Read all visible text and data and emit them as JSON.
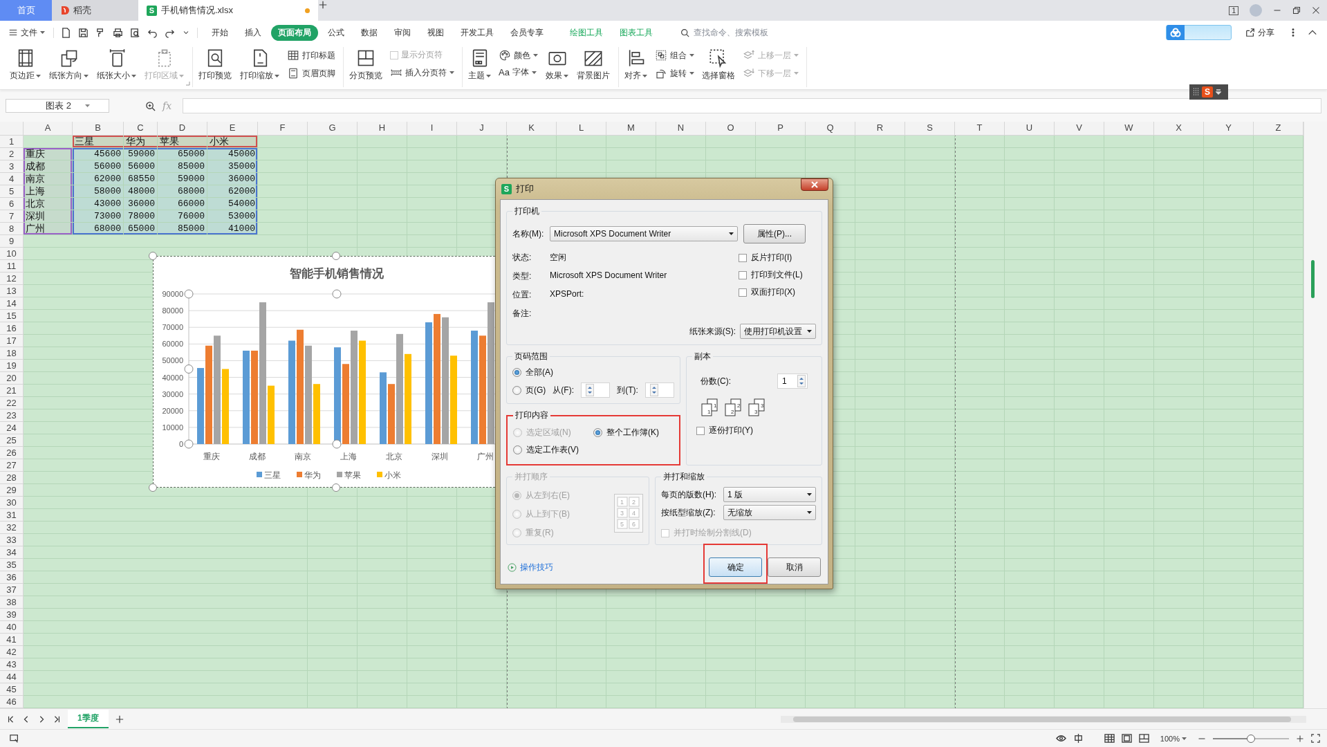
{
  "title_tabs": [
    {
      "label": "首页",
      "kind": "home",
      "selected": false
    },
    {
      "label": "稻壳",
      "kind": "app",
      "selected": false
    },
    {
      "label": "手机销售情况.xlsx",
      "kind": "file",
      "icon_letter": "S",
      "selected": true,
      "modified": true
    }
  ],
  "top_right": {
    "window_count": "1"
  },
  "menu": {
    "file": "文件",
    "tabs": [
      {
        "label": "开始",
        "kind": "standard",
        "selected": false
      },
      {
        "label": "插入",
        "kind": "standard",
        "selected": false
      },
      {
        "label": "页面布局",
        "kind": "standard",
        "selected": true
      },
      {
        "label": "公式",
        "kind": "standard",
        "selected": false
      },
      {
        "label": "数据",
        "kind": "standard",
        "selected": false
      },
      {
        "label": "审阅",
        "kind": "standard",
        "selected": false
      },
      {
        "label": "视图",
        "kind": "standard",
        "selected": false
      },
      {
        "label": "开发工具",
        "kind": "standard",
        "selected": false
      },
      {
        "label": "会员专享",
        "kind": "standard",
        "selected": false
      },
      {
        "label": "绘图工具",
        "kind": "context",
        "selected": false
      },
      {
        "label": "图表工具",
        "kind": "context",
        "selected": false
      }
    ],
    "search": {
      "placeholder": "查找命令、搜索模板"
    },
    "share": "分享"
  },
  "ribbon": {
    "groups": [
      {
        "launcher": true,
        "items": [
          {
            "kind": "large",
            "label": "页边距",
            "dropdown": true,
            "disabled": false
          },
          {
            "kind": "large",
            "label": "纸张方向",
            "dropdown": true,
            "disabled": false
          },
          {
            "kind": "large",
            "label": "纸张大小",
            "dropdown": true,
            "disabled": false
          },
          {
            "kind": "large",
            "label": "打印区域",
            "dropdown": true,
            "disabled": true
          }
        ]
      },
      {
        "items": [
          {
            "kind": "large",
            "label": "打印预览",
            "dropdown": false,
            "disabled": false
          },
          {
            "kind": "large",
            "label": "打印缩放",
            "dropdown": true,
            "disabled": false
          },
          {
            "kind": "stack",
            "items": [
              {
                "kind": "small",
                "label": "打印标题",
                "dropdown": false,
                "disabled": false
              },
              {
                "kind": "small",
                "label": "页眉页脚",
                "dropdown": false,
                "disabled": false
              }
            ]
          }
        ]
      },
      {
        "items": [
          {
            "kind": "large",
            "label": "分页预览",
            "dropdown": false,
            "disabled": false
          },
          {
            "kind": "stack",
            "items": [
              {
                "kind": "checkbox",
                "label": "显示分页符",
                "checked": false,
                "disabled": true
              },
              {
                "kind": "small",
                "label": "插入分页符",
                "dropdown": true,
                "disabled": false
              }
            ]
          }
        ]
      },
      {
        "items": [
          {
            "kind": "large",
            "label": "主题",
            "dropdown": true,
            "disabled": false
          },
          {
            "kind": "stack",
            "items": [
              {
                "kind": "small",
                "label": "颜色",
                "dropdown": true,
                "disabled": false
              },
              {
                "kind": "glyph",
                "glyph": "Aa",
                "label": "字体",
                "dropdown": true,
                "disabled": false
              }
            ]
          },
          {
            "kind": "large",
            "label": "效果",
            "dropdown": true,
            "disabled": false
          },
          {
            "kind": "large",
            "label": "背景图片",
            "dropdown": false,
            "disabled": false
          }
        ]
      },
      {
        "items": [
          {
            "kind": "large",
            "label": "对齐",
            "dropdown": true,
            "disabled": false
          },
          {
            "kind": "stack",
            "items": [
              {
                "kind": "small",
                "label": "组合",
                "dropdown": true,
                "disabled": false
              },
              {
                "kind": "small",
                "label": "旋转",
                "dropdown": true,
                "disabled": false
              }
            ]
          },
          {
            "kind": "large",
            "label": "选择窗格",
            "dropdown": false,
            "disabled": false
          },
          {
            "kind": "stack",
            "items": [
              {
                "kind": "small",
                "label": "上移一层",
                "dropdown": true,
                "disabled": true
              },
              {
                "kind": "small",
                "label": "下移一层",
                "dropdown": true,
                "disabled": true
              }
            ]
          }
        ]
      }
    ]
  },
  "ime_toolbar": {
    "logo": "S"
  },
  "formula_bar": {
    "name_box": "图表 2",
    "fx_label": "fx"
  },
  "sheet": {
    "columns": [
      "A",
      "B",
      "C",
      "D",
      "E",
      "F",
      "G",
      "H",
      "I",
      "J",
      "K",
      "L",
      "M",
      "N",
      "O",
      "P",
      "Q",
      "R",
      "S",
      "T",
      "U",
      "V",
      "W",
      "X",
      "Y",
      "Z"
    ],
    "header": {
      "row": "1",
      "brands": [
        "三星",
        "华为",
        "苹果",
        "小米"
      ]
    },
    "data_rows": [
      {
        "row": "2",
        "city": "重庆",
        "values": [
          "45600",
          "59000",
          "65000",
          "45000"
        ]
      },
      {
        "row": "3",
        "city": "成都",
        "values": [
          "56000",
          "56000",
          "85000",
          "35000"
        ]
      },
      {
        "row": "4",
        "city": "南京",
        "values": [
          "62000",
          "68550",
          "59000",
          "36000"
        ]
      },
      {
        "row": "5",
        "city": "上海",
        "values": [
          "58000",
          "48000",
          "68000",
          "62000"
        ]
      },
      {
        "row": "6",
        "city": "北京",
        "values": [
          "43000",
          "36000",
          "66000",
          "54000"
        ]
      },
      {
        "row": "7",
        "city": "深圳",
        "values": [
          "73000",
          "78000",
          "76000",
          "53000"
        ]
      },
      {
        "row": "8",
        "city": "广州",
        "values": [
          "68000",
          "65000",
          "85000",
          "41000"
        ]
      }
    ],
    "empty_rows": [
      "9",
      "10",
      "11",
      "12",
      "13",
      "14",
      "15",
      "16",
      "17",
      "18",
      "19",
      "20",
      "21",
      "22",
      "23",
      "24",
      "25",
      "26",
      "27",
      "28",
      "29",
      "30",
      "31",
      "32",
      "33",
      "34",
      "35",
      "36",
      "37",
      "38",
      "39",
      "40",
      "41",
      "42",
      "43",
      "44",
      "45",
      "46"
    ]
  },
  "chart": {
    "selected": true,
    "chart_data": {
      "type": "bar",
      "title": "智能手机销售情况",
      "categories": [
        "重庆",
        "成都",
        "南京",
        "上海",
        "北京",
        "深圳",
        "广州"
      ],
      "series": [
        {
          "name": "三星",
          "color": "#5b9bd5",
          "values": [
            45600,
            56000,
            62000,
            58000,
            43000,
            73000,
            68000
          ]
        },
        {
          "name": "华为",
          "color": "#ed7d31",
          "values": [
            59000,
            56000,
            68550,
            48000,
            36000,
            78000,
            65000
          ]
        },
        {
          "name": "苹果",
          "color": "#a5a5a5",
          "values": [
            65000,
            85000,
            59000,
            68000,
            66000,
            76000,
            85000
          ]
        },
        {
          "name": "小米",
          "color": "#ffc000",
          "values": [
            45000,
            35000,
            36000,
            62000,
            54000,
            53000,
            null
          ]
        }
      ],
      "grid": true,
      "legend": "bottom",
      "ylim": [
        0,
        90000
      ],
      "yticks": [
        0,
        10000,
        20000,
        30000,
        40000,
        50000,
        60000,
        70000,
        80000,
        90000
      ]
    }
  },
  "dialog": {
    "title": "打印",
    "icon_letter": "S",
    "printer": {
      "title": "打印机",
      "name_label": "名称(M):",
      "name": "Microsoft XPS Document Writer",
      "properties_button": "属性(P)...",
      "info": [
        {
          "label": "状态:",
          "value": "空闲"
        },
        {
          "label": "类型:",
          "value": "Microsoft XPS Document Writer"
        },
        {
          "label": "位置:",
          "value": "XPSPort:"
        },
        {
          "label": "备注:"
        }
      ],
      "options": [
        {
          "label": "反片打印(I)",
          "checked": false
        },
        {
          "label": "打印到文件(L)",
          "checked": false
        },
        {
          "label": "双面打印(X)",
          "checked": false
        }
      ],
      "source_label": "纸张来源(S):",
      "source": "使用打印机设置"
    },
    "page_range": {
      "title": "页码范围",
      "options": [
        {
          "label": "全部(A)",
          "selected": true
        },
        {
          "label": "页(G)",
          "selected": false
        }
      ],
      "from_label": "从(F):",
      "to_label": "到(T):"
    },
    "print_content": {
      "title": "打印内容",
      "highlighted": true,
      "options": [
        {
          "label": "选定区域(N)",
          "selected": false,
          "disabled": true
        },
        {
          "label": "整个工作簿(K)",
          "selected": true,
          "disabled": false
        },
        {
          "label": "选定工作表(V)",
          "selected": false,
          "disabled": false
        }
      ]
    },
    "copies": {
      "title": "副本",
      "count_label": "份数(C):",
      "count": "1",
      "collate_pages": [
        {
          "back": "1",
          "front": "1"
        },
        {
          "back": "2",
          "front": "2"
        },
        {
          "back": "3",
          "front": "3"
        }
      ],
      "collate": {
        "label": "逐份打印(Y)",
        "checked": false
      }
    },
    "order": {
      "title": "并打顺序",
      "disabled": true,
      "options": [
        {
          "label": "从左到右(E)",
          "selected": true
        },
        {
          "label": "从上到下(B)",
          "selected": false
        },
        {
          "label": "重复(R)",
          "selected": false
        }
      ],
      "preview": [
        "1",
        "2",
        "3",
        "4",
        "5",
        "6"
      ]
    },
    "scaling": {
      "title": "并打和缩放",
      "per_page_label": "每页的版数(H):",
      "per_page": "1 版",
      "scale_label": "按纸型缩放(Z):",
      "scale": "无缩放",
      "divider": {
        "label": "并打时绘制分割线(D)",
        "checked": false,
        "disabled": true
      }
    },
    "tips_link": "操作技巧",
    "ok_button": {
      "label": "确定",
      "highlighted": true
    },
    "cancel_button": "取消"
  },
  "sheet_tabs": [
    {
      "label": "1季度",
      "selected": true
    }
  ],
  "status_bar": {
    "zoom": "100%",
    "zoom_slider": {
      "level": 0.5
    }
  }
}
